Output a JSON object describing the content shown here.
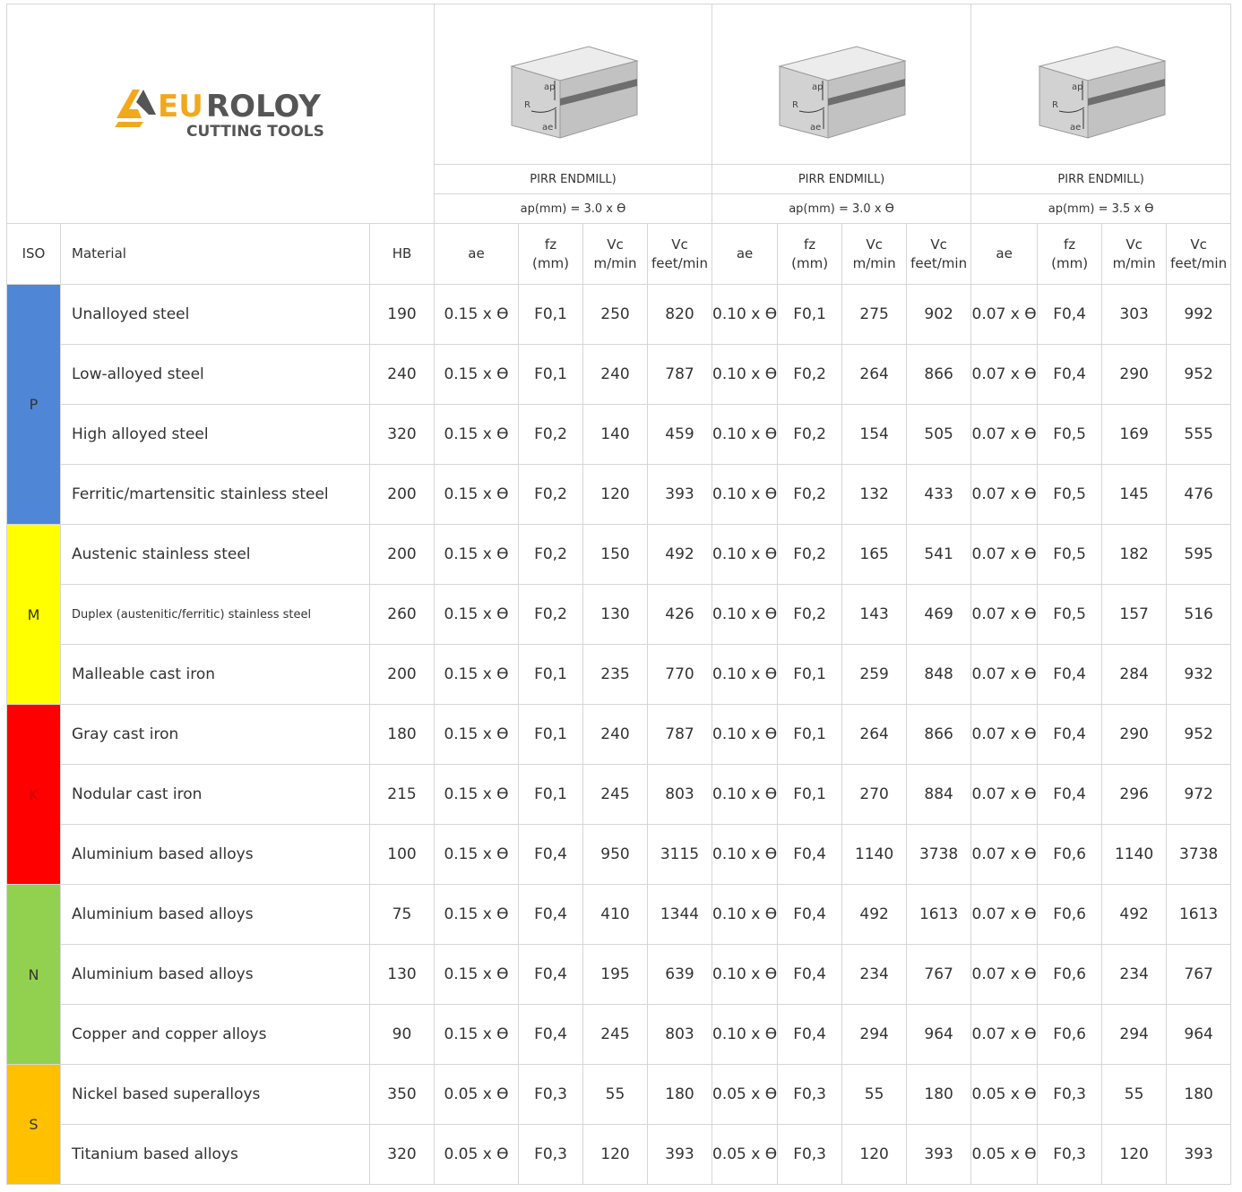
{
  "brand": {
    "name": "EUROLOY",
    "tagline": "CUTTING TOOLS",
    "colors": {
      "orange": "#F2A81D",
      "dark": "#555555"
    }
  },
  "tools": [
    {
      "diagram_labels": [
        "ap",
        "R",
        "ae"
      ],
      "name": "PIRR ENDMILL)",
      "ap": "ap(mm) = 3.0 x ϴ"
    },
    {
      "diagram_labels": [
        "ap",
        "R",
        "ae"
      ],
      "name": "PIRR ENDMILL)",
      "ap": "ap(mm) = 3.0 x ϴ"
    },
    {
      "diagram_labels": [
        "ap",
        "R",
        "ae"
      ],
      "name": "PIRR ENDMILL)",
      "ap": "ap(mm) = 3.5 x ϴ"
    }
  ],
  "columns": {
    "iso": "ISO",
    "material": "Material",
    "hb": "HB",
    "ae": "ae",
    "fz": [
      "fz",
      "(mm)"
    ],
    "vc_m": [
      "Vc",
      "m/min"
    ],
    "vc_ft": [
      "Vc",
      "feet/min"
    ]
  },
  "iso_groups": [
    {
      "code": "P",
      "color": "#4F86D6",
      "text_color": "#333333"
    },
    {
      "code": "M",
      "color": "#FFFF00",
      "text_color": "#333333"
    },
    {
      "code": "K",
      "color": "#FF0000",
      "text_color": "#cc0000"
    },
    {
      "code": "N",
      "color": "#92D050",
      "text_color": "#333333"
    },
    {
      "code": "S",
      "color": "#FFC000",
      "text_color": "#333333"
    }
  ],
  "rows": [
    {
      "material": "Unalloyed steel",
      "hb": "190",
      "c": [
        [
          "0.15 x ϴ",
          "F0,1",
          "250",
          "820"
        ],
        [
          "0.10 x ϴ",
          "F0,1",
          "275",
          "902"
        ],
        [
          "0.07 x ϴ",
          "F0,4",
          "303",
          "992"
        ]
      ]
    },
    {
      "material": "Low-alloyed steel",
      "hb": "240",
      "c": [
        [
          "0.15 x ϴ",
          "F0,1",
          "240",
          "787"
        ],
        [
          "0.10 x ϴ",
          "F0,2",
          "264",
          "866"
        ],
        [
          "0.07 x ϴ",
          "F0,4",
          "290",
          "952"
        ]
      ]
    },
    {
      "material": "High alloyed steel",
      "hb": "320",
      "c": [
        [
          "0.15 x ϴ",
          "F0,2",
          "140",
          "459"
        ],
        [
          "0.10 x ϴ",
          "F0,2",
          "154",
          "505"
        ],
        [
          "0.07 x ϴ",
          "F0,5",
          "169",
          "555"
        ]
      ]
    },
    {
      "material": "Ferritic/martensitic stainless steel",
      "hb": "200",
      "c": [
        [
          "0.15 x ϴ",
          "F0,2",
          "120",
          "393"
        ],
        [
          "0.10 x ϴ",
          "F0,2",
          "132",
          "433"
        ],
        [
          "0.07 x ϴ",
          "F0,5",
          "145",
          "476"
        ]
      ]
    },
    {
      "material": "Austenic stainless steel",
      "hb": "200",
      "c": [
        [
          "0.15 x ϴ",
          "F0,2",
          "150",
          "492"
        ],
        [
          "0.10 x ϴ",
          "F0,2",
          "165",
          "541"
        ],
        [
          "0.07 x ϴ",
          "F0,5",
          "182",
          "595"
        ]
      ]
    },
    {
      "material": "Duplex (austenitic/ferritic) stainless steel",
      "hb": "260",
      "c": [
        [
          "0.15 x ϴ",
          "F0,2",
          "130",
          "426"
        ],
        [
          "0.10 x ϴ",
          "F0,2",
          "143",
          "469"
        ],
        [
          "0.07 x ϴ",
          "F0,5",
          "157",
          "516"
        ]
      ]
    },
    {
      "material": "Malleable cast iron",
      "hb": "200",
      "c": [
        [
          "0.15 x ϴ",
          "F0,1",
          "235",
          "770"
        ],
        [
          "0.10 x ϴ",
          "F0,1",
          "259",
          "848"
        ],
        [
          "0.07 x ϴ",
          "F0,4",
          "284",
          "932"
        ]
      ]
    },
    {
      "material": "Gray cast iron",
      "hb": "180",
      "c": [
        [
          "0.15 x ϴ",
          "F0,1",
          "240",
          "787"
        ],
        [
          "0.10 x ϴ",
          "F0,1",
          "264",
          "866"
        ],
        [
          "0.07 x ϴ",
          "F0,4",
          "290",
          "952"
        ]
      ]
    },
    {
      "material": "Nodular cast iron",
      "hb": "215",
      "c": [
        [
          "0.15 x ϴ",
          "F0,1",
          "245",
          "803"
        ],
        [
          "0.10 x ϴ",
          "F0,1",
          "270",
          "884"
        ],
        [
          "0.07 x ϴ",
          "F0,4",
          "296",
          "972"
        ]
      ]
    },
    {
      "material": "Aluminium based alloys",
      "hb": "100",
      "c": [
        [
          "0.15 x ϴ",
          "F0,4",
          "950",
          "3115"
        ],
        [
          "0.10 x ϴ",
          "F0,4",
          "1140",
          "3738"
        ],
        [
          "0.07 x ϴ",
          "F0,6",
          "1140",
          "3738"
        ]
      ]
    },
    {
      "material": "Aluminium based alloys",
      "hb": "75",
      "c": [
        [
          "0.15 x ϴ",
          "F0,4",
          "410",
          "1344"
        ],
        [
          "0.10 x ϴ",
          "F0,4",
          "492",
          "1613"
        ],
        [
          "0.07 x ϴ",
          "F0,6",
          "492",
          "1613"
        ]
      ]
    },
    {
      "material": "Aluminium based alloys",
      "hb": "130",
      "c": [
        [
          "0.15 x ϴ",
          "F0,4",
          "195",
          "639"
        ],
        [
          "0.10 x ϴ",
          "F0,4",
          "234",
          "767"
        ],
        [
          "0.07 x ϴ",
          "F0,6",
          "234",
          "767"
        ]
      ]
    },
    {
      "material": "Copper and copper alloys",
      "hb": "90",
      "c": [
        [
          "0.15 x ϴ",
          "F0,4",
          "245",
          "803"
        ],
        [
          "0.10 x ϴ",
          "F0,4",
          "294",
          "964"
        ],
        [
          "0.07 x ϴ",
          "F0,6",
          "294",
          "964"
        ]
      ]
    },
    {
      "material": "Nickel based superalloys",
      "hb": "350",
      "c": [
        [
          "0.05 x ϴ",
          "F0,3",
          "55",
          "180"
        ],
        [
          "0.05 x ϴ",
          "F0,3",
          "55",
          "180"
        ],
        [
          "0.05 x ϴ",
          "F0,3",
          "55",
          "180"
        ]
      ]
    },
    {
      "material": "Titanium based alloys",
      "hb": "320",
      "c": [
        [
          "0.05 x ϴ",
          "F0,3",
          "120",
          "393"
        ],
        [
          "0.05 x ϴ",
          "F0,3",
          "120",
          "393"
        ],
        [
          "0.05 x ϴ",
          "F0,3",
          "120",
          "393"
        ]
      ]
    }
  ]
}
